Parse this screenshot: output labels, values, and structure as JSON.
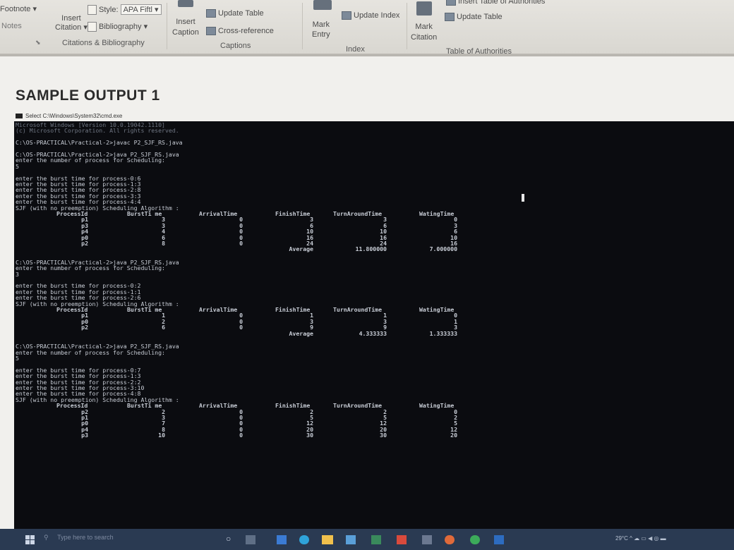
{
  "ribbon": {
    "footnote": "Footnote",
    "notes": "Notes",
    "insert_citation": [
      "Insert",
      "Citation"
    ],
    "style_label": "Style:",
    "style_value": "APA Fiftl",
    "bibliography": "Bibliography",
    "citations_group": "Citations & Bibliography",
    "insert_caption": [
      "Insert",
      "Caption"
    ],
    "update_table": "Update Table",
    "cross_reference": "Cross-reference",
    "captions_group": "Captions",
    "mark_entry": [
      "Mark",
      "Entry"
    ],
    "update_index": "Update Index",
    "index_group": "Index",
    "mark_citation": [
      "Mark",
      "Citation"
    ],
    "insert_toa": "Insert Table of Authorities",
    "update_table_2": "Update Table",
    "toa_group": "Table of Authorities"
  },
  "document": {
    "title": "SAMPLE OUTPUT 1",
    "window_title": "Select C:\\Windows\\System32\\cmd.exe"
  },
  "console": {
    "header": [
      "Microsoft Windows [Version 10.0.19042.1110]",
      "(c) Microsoft Corporation. All rights reserved.",
      "",
      "C:\\OS-PRACTICAL\\Practical-2>javac P2_SJF_RS.java",
      "",
      "C:\\OS-PRACTICAL\\Practical-2>java P2_SJF_RS.java",
      "enter the number of process for Scheduling:",
      "5",
      ""
    ],
    "run1_prompts": [
      "enter the burst time for process-0:6",
      "enter the burst time for process-1:3",
      "enter the burst time for process-2:8",
      "enter the burst time for process-3:3",
      "enter the burst time for process-4:4",
      "SJF (with no preemption) Scheduling Algorithm :"
    ],
    "columns": [
      "ProcessId",
      "BurstTi me",
      "ArrivalTime",
      "FinishTime",
      "TurnAroundTime",
      "WatingTime"
    ],
    "run1_rows": [
      [
        "p1",
        "3",
        "0",
        "3",
        "3",
        "0"
      ],
      [
        "p3",
        "3",
        "0",
        "6",
        "6",
        "3"
      ],
      [
        "p4",
        "4",
        "0",
        "10",
        "10",
        "6"
      ],
      [
        "p0",
        "6",
        "0",
        "16",
        "16",
        "10"
      ],
      [
        "p2",
        "8",
        "0",
        "24",
        "24",
        "16"
      ]
    ],
    "run1_avg": [
      "Average",
      "11.800000",
      "7.000000"
    ],
    "run2_intro": [
      "C:\\OS-PRACTICAL\\Practical-2>java P2_SJF_RS.java",
      "enter the number of process for Scheduling:",
      "3",
      "",
      "enter the burst time for process-0:2",
      "enter the burst time for process-1:1",
      "enter the burst time for process-2:6",
      "SJF (with no preemption) Scheduling Algorithm :"
    ],
    "run2_rows": [
      [
        "p1",
        "1",
        "0",
        "1",
        "1",
        "0"
      ],
      [
        "p0",
        "2",
        "0",
        "3",
        "3",
        "1"
      ],
      [
        "p2",
        "6",
        "0",
        "9",
        "9",
        "3"
      ]
    ],
    "run2_avg": [
      "Average",
      "4.333333",
      "1.333333"
    ],
    "run3_intro": [
      "C:\\OS-PRACTICAL\\Practical-2>java P2_SJF_RS.java",
      "enter the number of process for Scheduling:",
      "5",
      "",
      "enter the burst time for process-0:7",
      "enter the burst time for process-1:3",
      "enter the burst time for process-2:2",
      "enter the burst time for process-3:10",
      "enter the burst time for process-4:8",
      "SJF (with no preemption) Scheduling Algorithm :"
    ],
    "run3_rows": [
      [
        "p2",
        "2",
        "0",
        "2",
        "2",
        "0"
      ],
      [
        "p1",
        "3",
        "0",
        "5",
        "5",
        "2"
      ],
      [
        "p0",
        "7",
        "0",
        "12",
        "12",
        "5"
      ],
      [
        "p4",
        "8",
        "0",
        "20",
        "20",
        "12"
      ],
      [
        "p3",
        "10",
        "0",
        "30",
        "30",
        "20"
      ]
    ]
  },
  "taskbar": {
    "search_placeholder": "Type here to search",
    "temperature": "29°C"
  }
}
